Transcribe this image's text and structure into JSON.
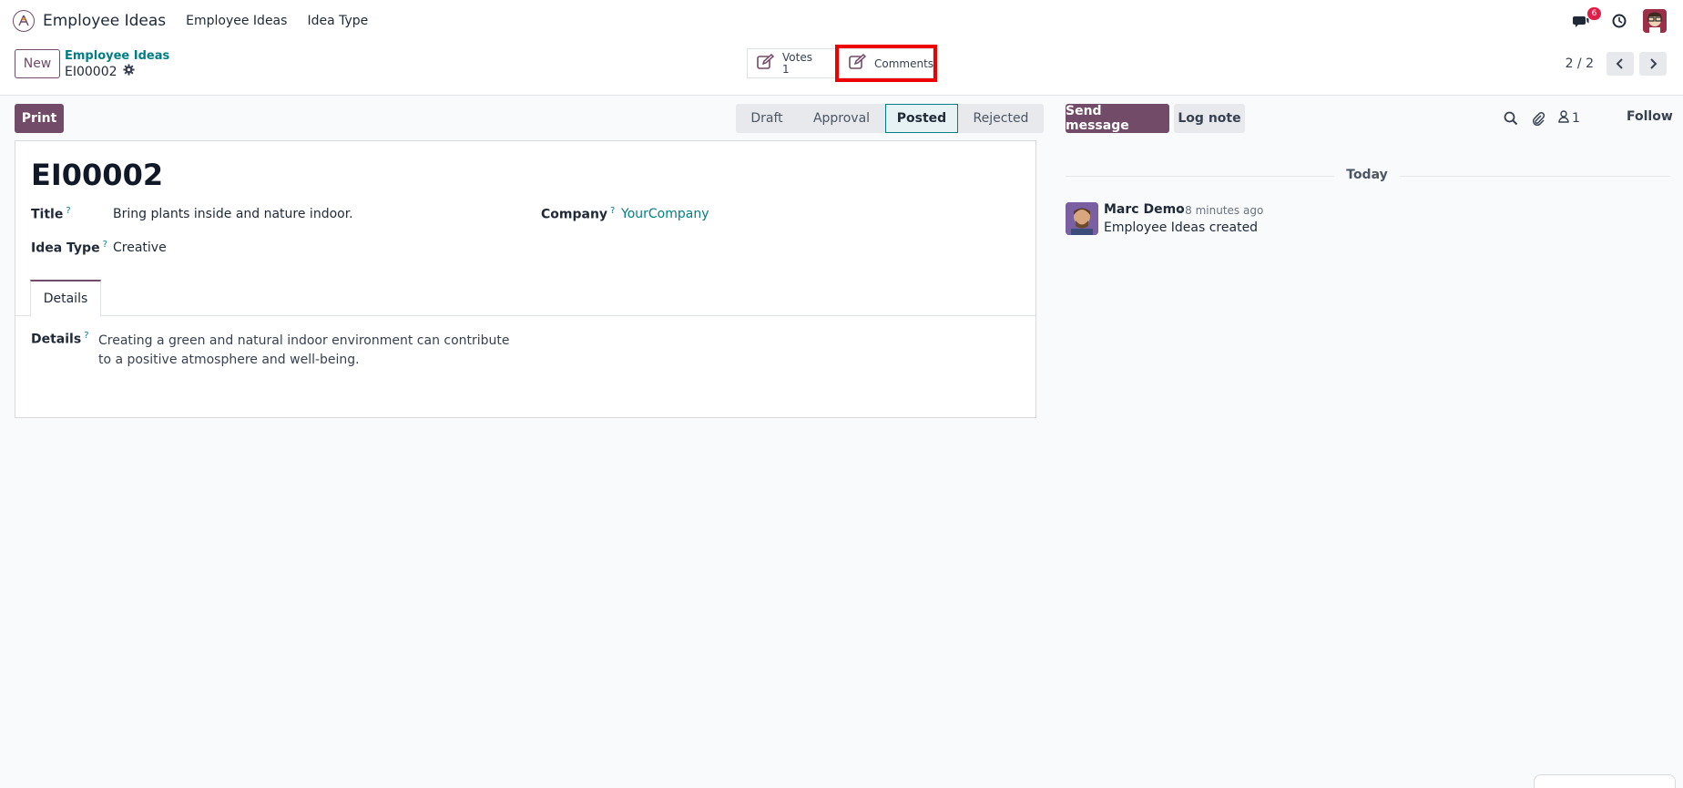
{
  "navbar": {
    "app_name": "Employee Ideas",
    "menu": [
      "Employee Ideas",
      "Idea Type"
    ],
    "chat_badge": "6"
  },
  "breadcrumb": {
    "parent": "Employee Ideas",
    "current": "EI00002"
  },
  "toolbar": {
    "new_label": "New",
    "print_label": "Print"
  },
  "smart_buttons": {
    "votes_label": "Votes",
    "votes_count": "1",
    "comments_label": "Comments"
  },
  "pager": {
    "value": "2 / 2"
  },
  "status": {
    "stages": [
      "Draft",
      "Approval",
      "Posted",
      "Rejected"
    ],
    "current": "Posted"
  },
  "record": {
    "name": "EI00002",
    "title_label": "Title",
    "title_value": "Bring plants inside and nature indoor.",
    "idea_type_label": "Idea Type",
    "idea_type_value": "Creative",
    "company_label": "Company",
    "company_value": "YourCompany",
    "help_mark": "?",
    "tab_label": "Details",
    "details_label": "Details",
    "details_value": "Creating a green and natural indoor environment can contribute to a positive atmosphere and well-being."
  },
  "chatter": {
    "send_label": "Send message",
    "log_label": "Log note",
    "followers_count": "1",
    "follow_label": "Follow",
    "date_separator": "Today",
    "message": {
      "author": "Marc Demo",
      "time": "- 8 minutes ago",
      "body": "Employee Ideas created"
    }
  },
  "colors": {
    "primary": "#714b67",
    "link": "#017e84",
    "highlight_box": "#ee0000"
  }
}
